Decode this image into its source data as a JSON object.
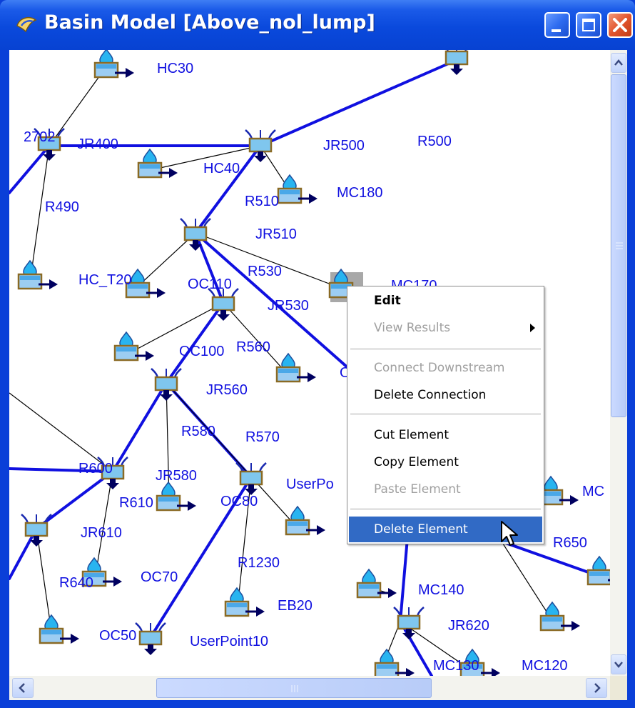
{
  "window": {
    "title": "Basin Model [Above_nol_lump]",
    "controls": [
      "minimize",
      "maximize",
      "close"
    ]
  },
  "canvas": {
    "labels": [
      "HC30",
      "2702",
      "JR400",
      "JR500",
      "R500",
      "HC40",
      "MC180",
      "R510",
      "R490",
      "JR510",
      "R530",
      "HC_T20",
      "OC110",
      "MC170",
      "JR530",
      "OC100",
      "R560",
      "JR560",
      "R580",
      "R570",
      "R600",
      "JR580",
      "UserPo",
      "R610",
      "OC80",
      "JR610",
      "R640",
      "OC70",
      "R1230",
      "EB20",
      "OC50",
      "UserPoint10",
      "MC",
      "R650",
      "MC140",
      "JR620",
      "MC130",
      "MC120",
      "O"
    ]
  },
  "context_menu": {
    "items": [
      {
        "label": "Edit",
        "state": "bold"
      },
      {
        "label": "View Results",
        "state": "disabled",
        "submenu": true
      },
      {
        "separator": true
      },
      {
        "label": "Connect Downstream",
        "state": "disabled"
      },
      {
        "label": "Delete Connection",
        "state": "enabled"
      },
      {
        "separator": true
      },
      {
        "label": "Cut Element",
        "state": "enabled"
      },
      {
        "label": "Copy Element",
        "state": "enabled"
      },
      {
        "label": "Paste Element",
        "state": "disabled"
      },
      {
        "separator": true
      },
      {
        "label": "Delete Element",
        "state": "highlighted"
      }
    ]
  },
  "colors": {
    "title_bar": "#0a49dc",
    "link_line": "#1010e0",
    "label_text": "#1010e0",
    "menu_highlight": "#316ac5"
  },
  "icons": {
    "subbasin": "subbasin-icon",
    "junction": "junction-icon",
    "app": "basin-model-icon"
  }
}
